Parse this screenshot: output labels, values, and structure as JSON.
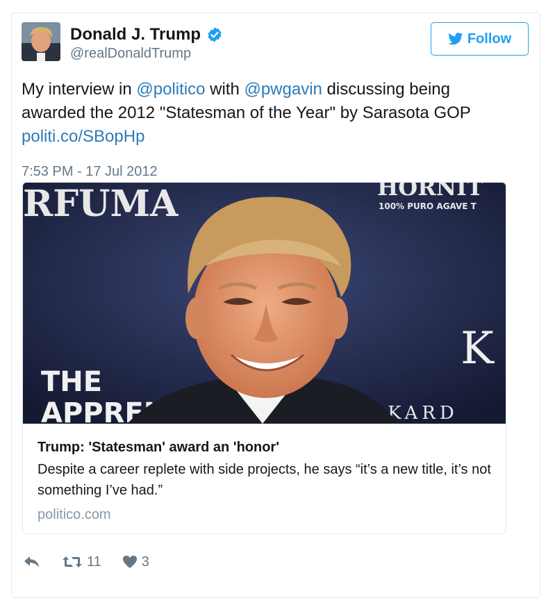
{
  "user": {
    "display_name": "Donald J. Trump",
    "handle": "@realDonaldTrump",
    "verified": true
  },
  "follow_button": {
    "label": "Follow",
    "icon": "bird-icon"
  },
  "tweet": {
    "part1": "My interview in ",
    "mention1": "@politico",
    "part2": " with ",
    "mention2": "@pwgavin",
    "part3": " discussing being awarded the 2012 \"Statesman of the Year\" by Sarasota GOP ",
    "link": "politi.co/SBopHp",
    "timestamp": "7:53 PM - 17 Jul 2012"
  },
  "media": {
    "photo_text": {
      "top_left": "RFUMA",
      "top_right": "HORNIT",
      "agave": "100% PURO AGAVE T",
      "apprentice_1": "THE",
      "apprentice_2": "APPREN",
      "bottom_right": "IM KARD",
      "logo": "K"
    },
    "title": "Trump: 'Statesman' award an 'honor'",
    "description": "Despite a career replete with side projects, he says “it’s a new title, it’s not something I’ve had.”",
    "domain": "politico.com"
  },
  "actions": {
    "retweet_count": "11",
    "like_count": "3"
  },
  "colors": {
    "link": "#2b7bb9",
    "accent": "#1da1f2",
    "secondary_text": "#657786"
  }
}
